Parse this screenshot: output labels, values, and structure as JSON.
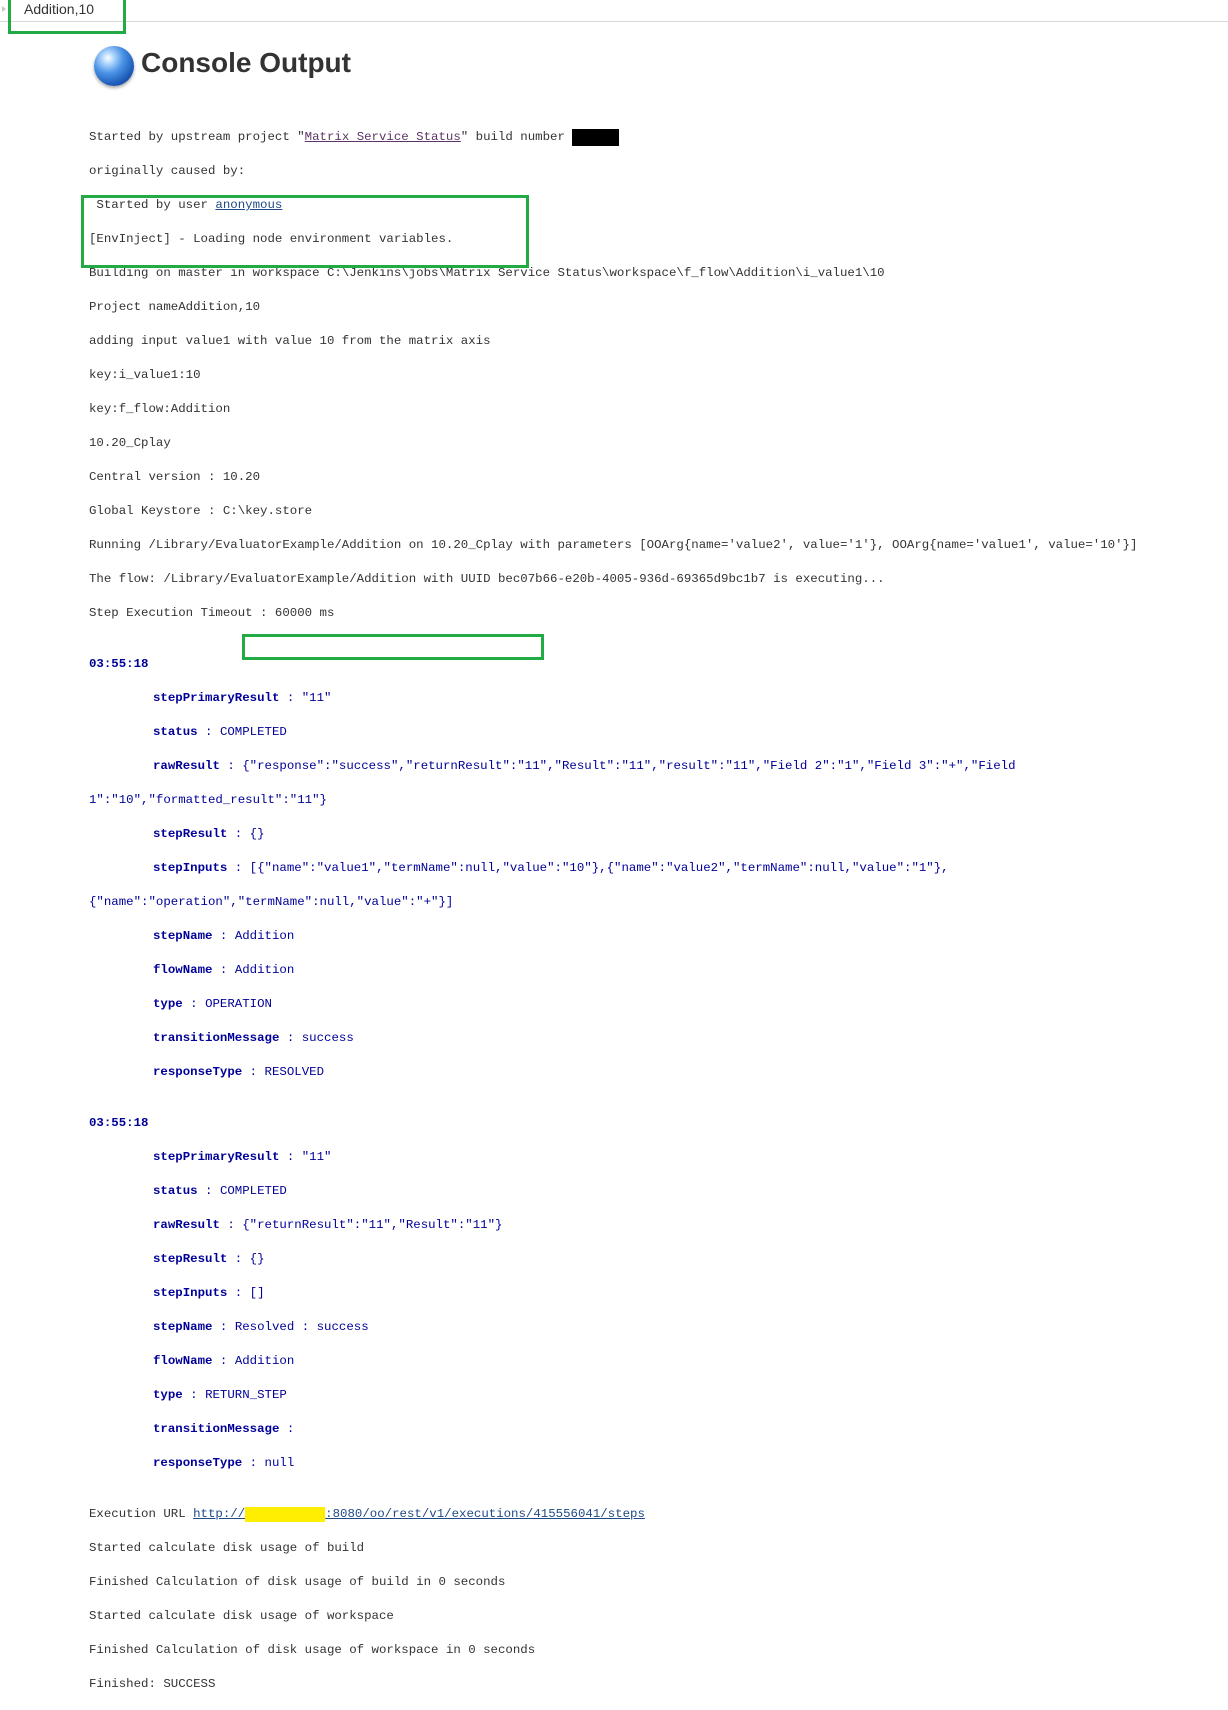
{
  "breadcrumb": {
    "item": "Addition,10"
  },
  "page": {
    "title": "Console Output",
    "icon": "blue-ball-icon"
  },
  "colors": {
    "highlight_box": "#22aa44",
    "step_text": "#000099",
    "link": "#204a87",
    "visited_link": "#5c3566"
  },
  "console": {
    "started_prefix": "Started by upstream project \"",
    "upstream_project": "Matrix Service Status",
    "started_suffix": "\" build number ",
    "caused_by": "originally caused by:",
    "started_by_user_prefix": " Started by user ",
    "user": "anonymous",
    "envinject": "[EnvInject] - Loading node environment variables.",
    "building": "Building on master in workspace C:\\Jenkins\\jobs\\Matrix Service Status\\workspace\\f_flow\\Addition\\i_value1\\10",
    "project_name": "Project nameAddition,10",
    "adding_input": "adding input value1 with value 10 from the matrix axis",
    "key1": "key:i_value1:10",
    "key2": "key:f_flow:Addition",
    "cplay": "10.20_Cplay",
    "central_version": "Central version : 10.20",
    "keystore": "Global Keystore : C:\\key.store",
    "running": "Running /Library/EvaluatorExample/Addition on 10.20_Cplay with parameters [OOArg{name='value2', value='1'}, OOArg{name='value1', value='10'}]",
    "the_flow": "The flow: /Library/EvaluatorExample/Addition with UUID bec07b66-e20b-4005-936d-69365d9bc1b7 is executing...",
    "timeout": "Step Execution Timeout : 60000 ms",
    "steps": [
      {
        "time": "03:55:18",
        "stepPrimaryResult": "\"11\"",
        "status": "COMPLETED",
        "rawResult_line1": "{\"response\":\"success\",\"returnResult\":\"11\",\"Result\":\"11\",\"result\":\"11\",\"Field 2\":\"1\",\"Field 3\":\"+\",\"Field",
        "rawResult_line2": "1\":\"10\",\"formatted_result\":\"11\"}",
        "stepResult": "{}",
        "stepInputs_line1": "[{\"name\":\"value1\",\"termName\":null,\"value\":\"10\"},{\"name\":\"value2\",\"termName\":null,\"value\":\"1\"},",
        "stepInputs_line2": "{\"name\":\"operation\",\"termName\":null,\"value\":\"+\"}]",
        "stepName": "Addition",
        "flowName": "Addition",
        "type": "OPERATION",
        "transitionMessage": "success",
        "responseType": "RESOLVED"
      },
      {
        "time": "03:55:18",
        "stepPrimaryResult": "\"11\"",
        "status": "COMPLETED",
        "rawResult": "{\"returnResult\":\"11\",\"Result\":\"11\"}",
        "stepResult": "{}",
        "stepInputs": "[]",
        "stepName": "Resolved : success",
        "flowName": "Addition",
        "type": "RETURN_STEP",
        "transitionMessage": "",
        "responseType": "null"
      }
    ],
    "labels": {
      "stepPrimaryResult": "stepPrimaryResult",
      "status": "status",
      "rawResult": "rawResult",
      "stepResult": "stepResult",
      "stepInputs": "stepInputs",
      "stepName": "stepName",
      "flowName": "flowName",
      "type": "type",
      "transitionMessage": "transitionMessage",
      "responseType": "responseType"
    },
    "exec_url_prefix": "Execution URL ",
    "exec_url_link_start": "http://",
    "exec_url_link_end": ":8080/oo/rest/v1/executions/415556041/steps",
    "disk1": "Started calculate disk usage of build",
    "disk2": "Finished Calculation of disk usage of build in 0 seconds",
    "disk3": "Started calculate disk usage of workspace",
    "disk4": "Finished Calculation of disk usage of workspace in 0 seconds",
    "finished": "Finished: SUCCESS"
  }
}
